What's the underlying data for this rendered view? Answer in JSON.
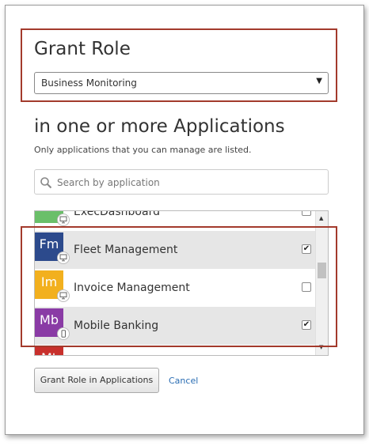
{
  "dialog": {
    "title": "Grant Role",
    "role_select": {
      "value": "Business Monitoring"
    },
    "apps_title": "in one or more Applications",
    "hint": "Only applications that you can manage are listed.",
    "search": {
      "placeholder": "Search by application",
      "value": ""
    },
    "apps": [
      {
        "abbr": "",
        "name": "ExecDashboard",
        "color": "#6abf69",
        "checked": false,
        "selected": false,
        "badge": "monitor-icon"
      },
      {
        "abbr": "Fm",
        "name": "Fleet Management",
        "color": "#2c4a8c",
        "checked": true,
        "selected": true,
        "badge": "monitor-icon"
      },
      {
        "abbr": "Im",
        "name": "Invoice Management",
        "color": "#f2b01e",
        "checked": false,
        "selected": false,
        "badge": "monitor-icon"
      },
      {
        "abbr": "Mb",
        "name": "Mobile Banking",
        "color": "#8a3ba5",
        "checked": true,
        "selected": true,
        "badge": "mobile-icon"
      },
      {
        "abbr": "Mt",
        "name": "",
        "color": "#c8302c",
        "checked": false,
        "selected": false,
        "badge": ""
      }
    ],
    "grant_button": "Grant Role in Applications",
    "cancel_link": "Cancel"
  },
  "highlight_color": "#a33a2c",
  "link_color": "#2a6db3"
}
